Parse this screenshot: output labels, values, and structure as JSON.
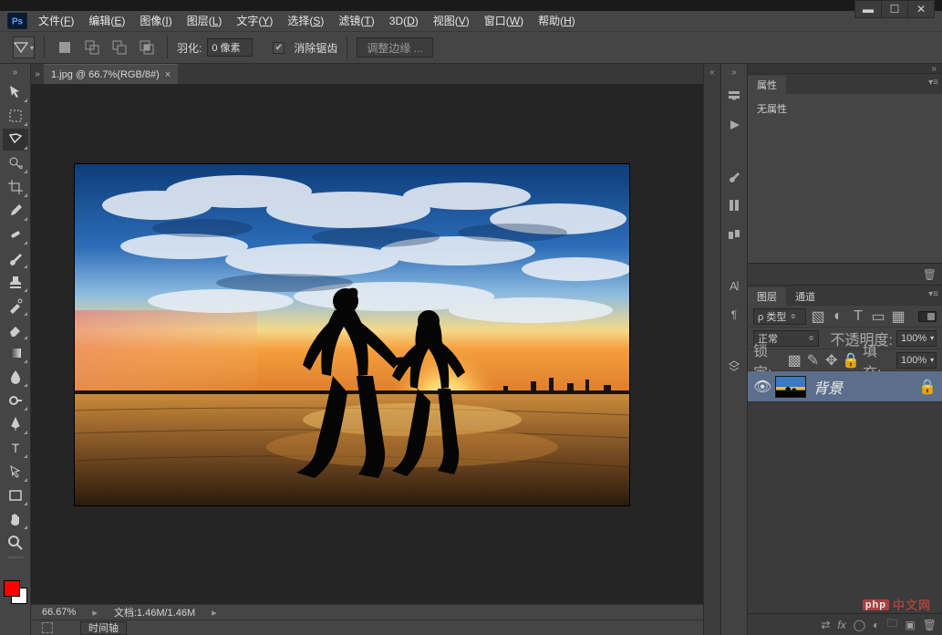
{
  "window": {
    "min": "▬",
    "max": "☐",
    "close": "✕"
  },
  "menu": {
    "items": [
      {
        "l": "文件",
        "k": "F"
      },
      {
        "l": "编辑",
        "k": "E"
      },
      {
        "l": "图像",
        "k": "I"
      },
      {
        "l": "图层",
        "k": "L"
      },
      {
        "l": "文字",
        "k": "Y"
      },
      {
        "l": "选择",
        "k": "S"
      },
      {
        "l": "滤镜",
        "k": "T"
      },
      {
        "l": "3D",
        "k": "D"
      },
      {
        "l": "视图",
        "k": "V"
      },
      {
        "l": "窗口",
        "k": "W"
      },
      {
        "l": "帮助",
        "k": "H"
      }
    ]
  },
  "options": {
    "feather_label": "羽化:",
    "feather_value": "0 像素",
    "antialias": "消除锯齿",
    "refine": "调整边缘 ..."
  },
  "tab": {
    "title": "1.jpg @ 66.7%(RGB/8#)"
  },
  "status": {
    "zoom": "66.67%",
    "doc_label": "文档:",
    "doc_value": "1.46M/1.46M",
    "timeline": "时间轴"
  },
  "panels": {
    "properties": {
      "tab": "属性",
      "body": "无属性"
    },
    "layers": {
      "tabs": [
        "图层",
        "通道"
      ],
      "filter_kind": "ρ 类型",
      "blend": "正常",
      "opacity_label": "不透明度:",
      "opacity_val": "100%",
      "lock_label": "锁定:",
      "fill_label": "填充:",
      "fill_val": "100%",
      "layer_name": "背景"
    }
  },
  "watermark": {
    "text": "中文网",
    "badge": "php"
  }
}
